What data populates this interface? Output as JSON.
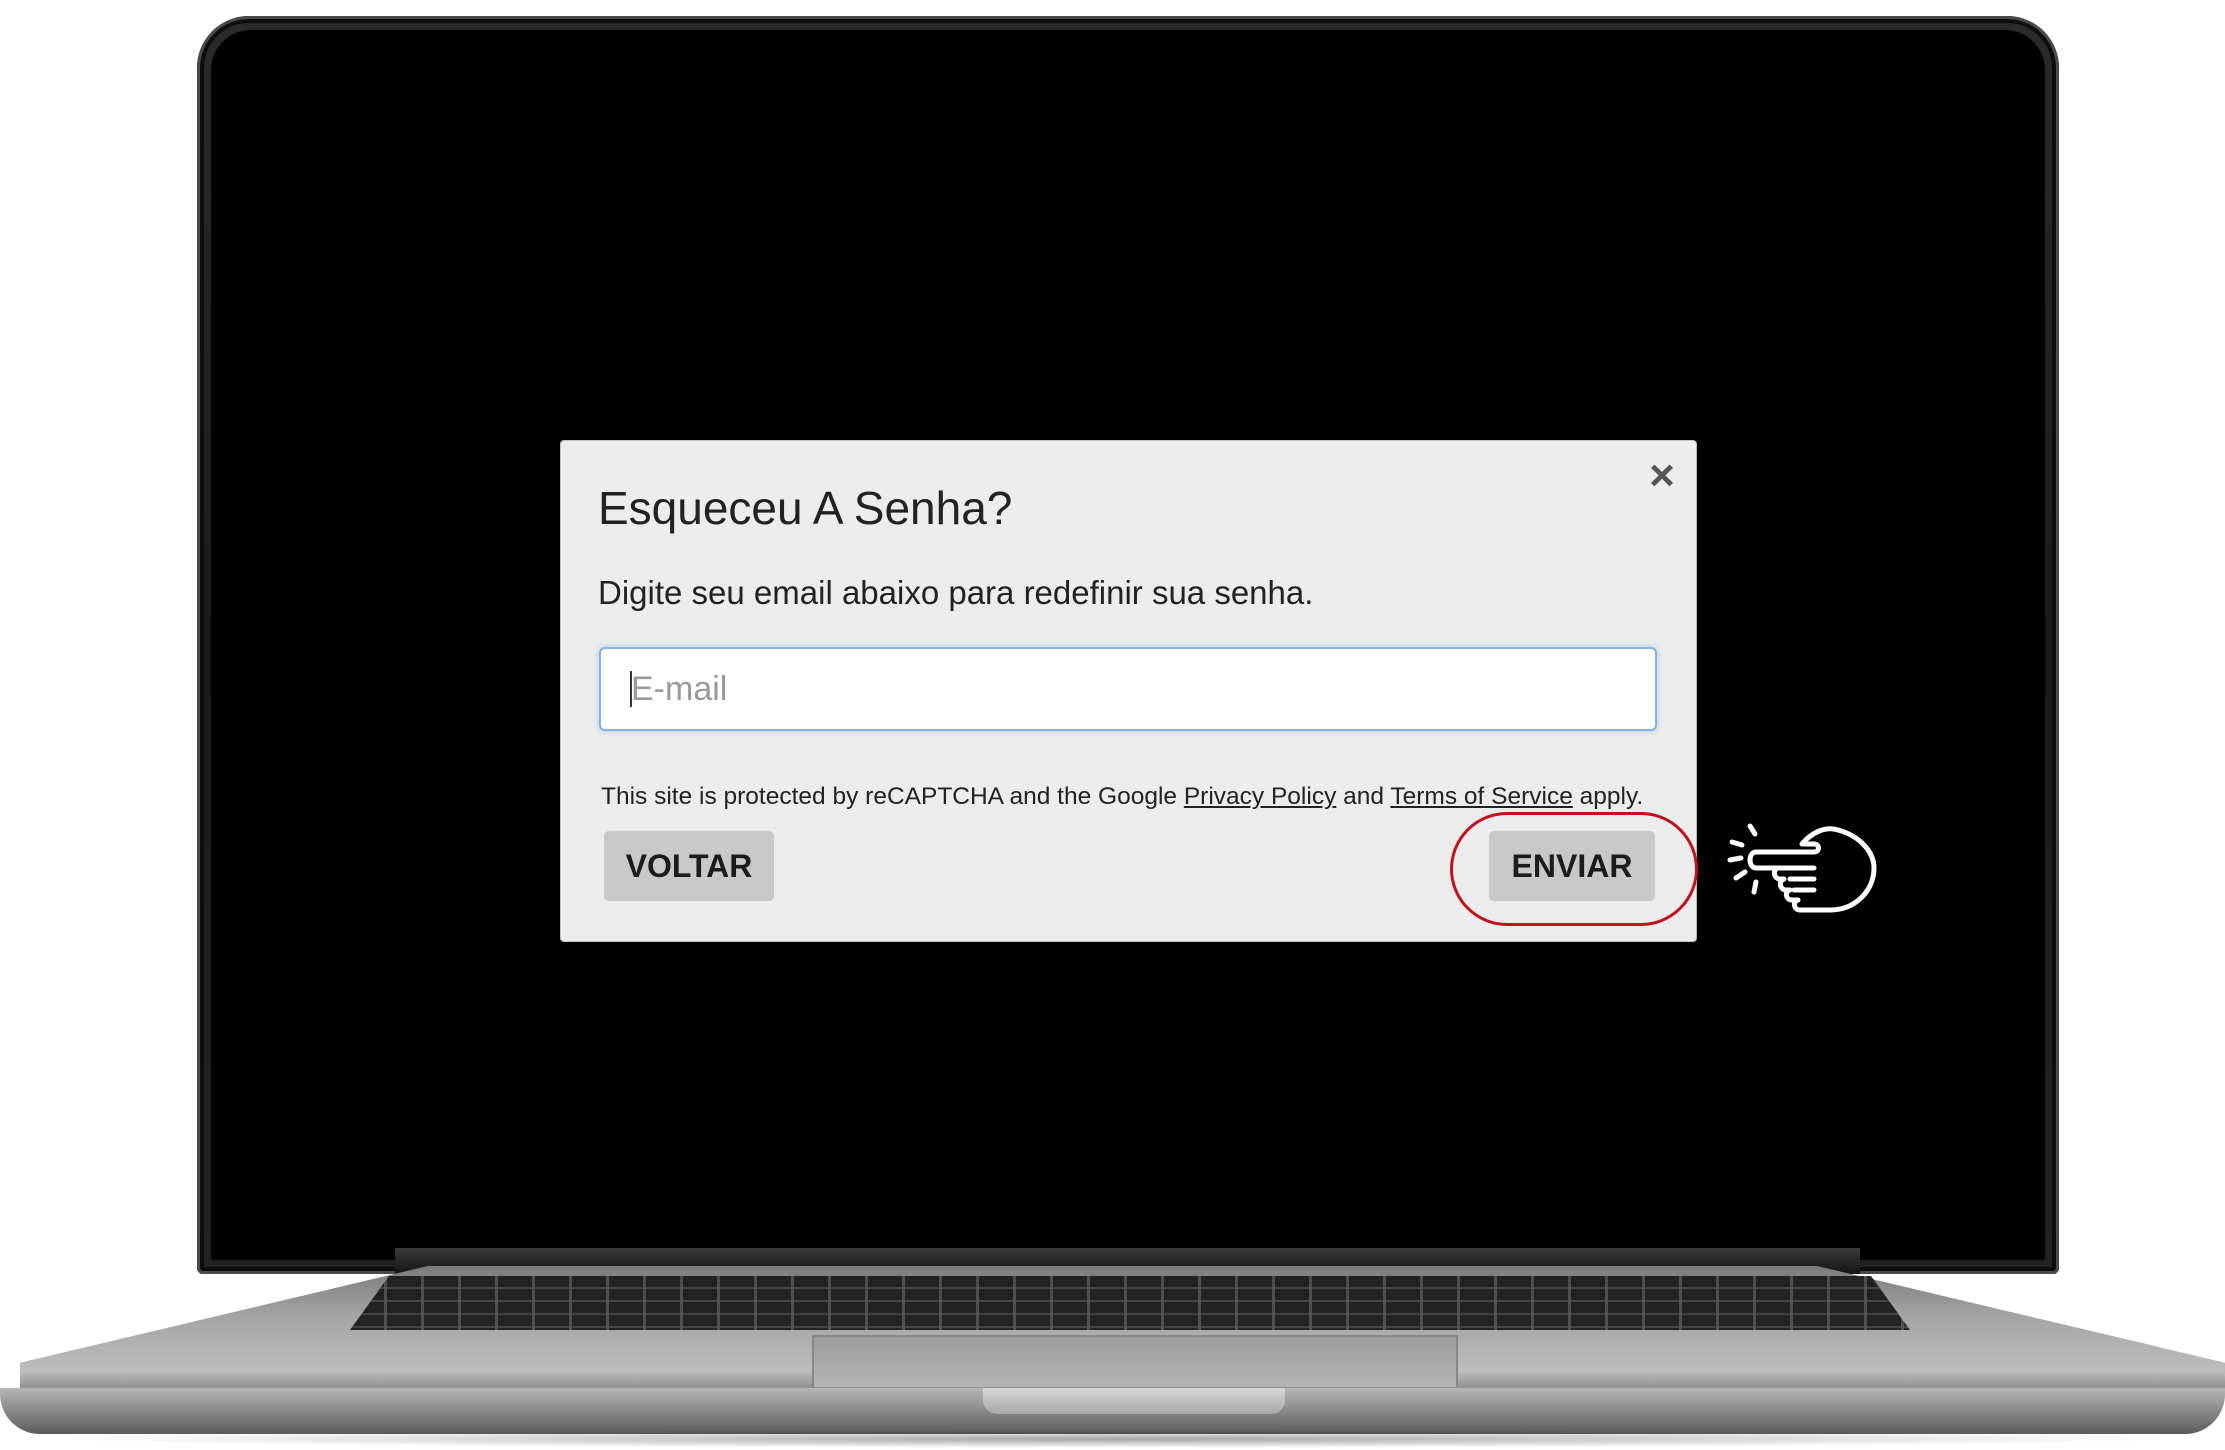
{
  "modal": {
    "close_symbol": "×",
    "title": "Esqueceu A Senha?",
    "subtitle": "Digite seu email abaixo para redefinir sua senha.",
    "email_placeholder": "E-mail",
    "recaptcha": {
      "prefix": "This site is protected by reCAPTCHA and the Google ",
      "privacy_link": "Privacy Policy",
      "middle": " and ",
      "terms_link": "Terms of Service",
      "suffix": " apply."
    },
    "back_label": "VOLTAR",
    "send_label": "ENVIAR"
  },
  "icons": {
    "close": "close-icon",
    "pointer": "pointing-hand-icon"
  },
  "colors": {
    "screen_background": "#000000",
    "modal_background": "#ececec",
    "button_background": "#c8c8c8",
    "input_focus_border": "#86b0dd",
    "highlight_ring": "#c0121d"
  }
}
